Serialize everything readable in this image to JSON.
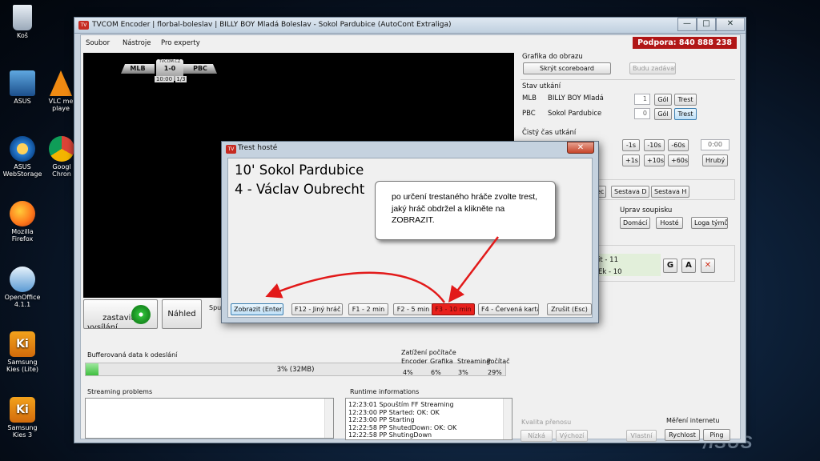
{
  "desktop": {
    "icons": [
      {
        "label": "Koš",
        "icon": "recycle-bin-icon"
      },
      {
        "label": "ASUS",
        "icon": "asus-folder-icon"
      },
      {
        "label": "VLC me\nplaye",
        "icon": "vlc-icon"
      },
      {
        "label": "ASUS\nWebStorage",
        "icon": "asus-webstorage-icon"
      },
      {
        "label": "Googl\nChron",
        "icon": "chrome-icon"
      },
      {
        "label": "Mozilla\nFirefox",
        "icon": "firefox-icon"
      },
      {
        "label": "OpenOffice\n4.1.1",
        "icon": "openoffice-icon"
      },
      {
        "label": "Samsung\nKies (Lite)",
        "icon": "kies-lite-icon"
      },
      {
        "label": "Samsung\nKies 3",
        "icon": "kies3-icon"
      }
    ],
    "brand": "/ISUS"
  },
  "window": {
    "title": "TVCOM Encoder | florbal-boleslav | BILLY BOY Mladá Boleslav - Sokol Pardubice (AutoCont Extraliga)",
    "controls": {
      "minimize": "—",
      "maximize": "□",
      "close": "✕"
    }
  },
  "menu": {
    "items": [
      "Soubor",
      "Nástroje",
      "Pro experty"
    ],
    "support": "Podpora: 840 888 238"
  },
  "scoreboard": {
    "brand": "TVCOM.CZ",
    "home": "MLB",
    "away": "PBC",
    "score": "1-0",
    "time": "10:00",
    "period": "1/3"
  },
  "graphics": {
    "title": "Grafika do obrazu",
    "hide_scoreboard": "Skrýt scoreboard",
    "placeholder_btn": "Budu zadávat"
  },
  "match_state": {
    "title": "Stav utkání",
    "teams": [
      {
        "abbr": "MLB",
        "name": "BILLY BOY Mladá",
        "goals": "1",
        "goal_btn": "Gól",
        "penalty_btn": "Trest"
      },
      {
        "abbr": "PBC",
        "name": "Sokol Pardubice",
        "goals": "0",
        "goal_btn": "Gól",
        "penalty_btn": "Trest"
      }
    ]
  },
  "clock": {
    "title": "Čistý čas utkání",
    "minus": [
      "-1s",
      "-10s",
      "-60s"
    ],
    "plus": [
      "+1s",
      "+10s",
      "+60s"
    ],
    "value": "0:00",
    "rough_btn": "Hrubý"
  },
  "lineups": {
    "partial": "ec",
    "home_btn": "Sestava D",
    "away_btn": "Sestava H"
  },
  "edit_lineup": {
    "title": "Uprav soupisku",
    "home": "Domácí",
    "away": "Hosté",
    "logos": "Loga týmů"
  },
  "events": {
    "row1": "it - 11",
    "row2": "Ek - 10",
    "btn_g": "G",
    "btn_a": "A",
    "btn_x": "✕"
  },
  "broadcast": {
    "toggle": "zastavit\nvysílání",
    "preview": "Náhled",
    "partial_label": "Spu"
  },
  "buffer": {
    "label": "Bufferovaná data k odeslání",
    "percent": 3,
    "text": "3% (32MB)"
  },
  "load": {
    "title": "Zatížení počítače",
    "headers": [
      "Encoder",
      "Grafika",
      "Streaming",
      "Počítač"
    ],
    "values": [
      "4%",
      "6%",
      "3%",
      "29%"
    ]
  },
  "streaming_problems": {
    "title": "Streaming problems"
  },
  "runtime": {
    "title": "Runtime informations",
    "lines": [
      "12:23:01 Spouštím FF Streaming",
      "12:23:00 PP Started: OK: OK",
      "12:23:00 PP Starting",
      "12:22:58 PP ShutedDown: OK: OK",
      "12:22:58 PP ShutingDown"
    ]
  },
  "quality": {
    "title": "Kvalita přenosu",
    "low": "Nízká",
    "default": "Výchozí",
    "custom": "Vlastní"
  },
  "internet": {
    "title": "Měření internetu",
    "speed": "Rychlost",
    "ping": "Ping"
  },
  "dialog": {
    "title": "Trest hosté",
    "team_line": "10' Sokol Pardubice",
    "player_line": "4 -  Václav Oubrecht",
    "buttons": [
      "Zobrazit (Enter)",
      "F12 - Jiný hráč",
      "F1 - 2 min",
      "F2 - 5 min",
      "F3 - 10 min",
      "F4 - Červená karta",
      "Zrušit (Esc)"
    ],
    "close": "✕"
  },
  "callout": {
    "text": "po určení trestaného hráče zvolte trest, jaký hráč obdržel a klikněte na ZOBRAZIT."
  },
  "colors": {
    "accent_red": "#b11616",
    "penalty_selected": "#e8201c",
    "progress_green": "#3fbf3f"
  }
}
